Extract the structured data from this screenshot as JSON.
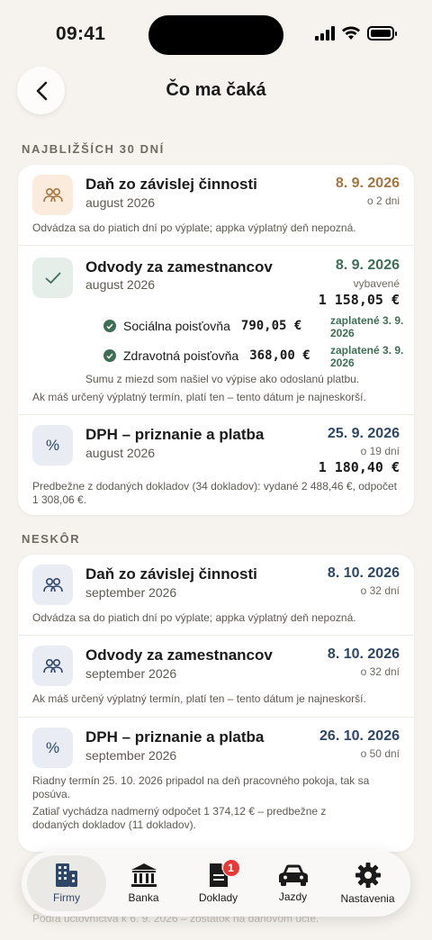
{
  "status": {
    "time": "09:41"
  },
  "header": {
    "title": "Čo ma čaká"
  },
  "sections": {
    "next30": "NAJBLIŽŠÍCH 30 DNÍ",
    "later": "NESKÔR"
  },
  "next30": {
    "tax1": {
      "title": "Daň zo závislej činnosti",
      "period": "august 2026",
      "date": "8. 9. 2026",
      "due_in": "o 2 dni",
      "note": "Odvádza sa do piatich dní po výplate; appka výplatný deň nepozná."
    },
    "contrib": {
      "title": "Odvody za zamestnancov",
      "period": "august 2026",
      "date": "8. 9. 2026",
      "status": "vybavené",
      "amount": "1 158,05 €",
      "rows": [
        {
          "label": "Sociálna poisťovňa",
          "amount": "790,05 €",
          "paid": "zaplatené 3. 9. 2026"
        },
        {
          "label": "Zdravotná poisťovňa",
          "amount": "368,00 €",
          "paid": "zaplatené 3. 9. 2026"
        }
      ],
      "note1": "Sumu z miezd som našiel vo výpise ako odoslanú platbu.",
      "note2": "Ak máš určený výplatný termín, platí ten – tento dátum je najneskorší."
    },
    "vat": {
      "title": "DPH – priznanie a platba",
      "period": "august 2026",
      "date": "25. 9. 2026",
      "due_in": "o 19 dní",
      "amount": "1 180,40 €",
      "note": "Predbežne z dodaných dokladov (34 dokladov): vydané 2 488,46 €, odpočet 1 308,06 €."
    }
  },
  "later": {
    "tax2": {
      "title": "Daň zo závislej činnosti",
      "period": "september 2026",
      "date": "8. 10. 2026",
      "due_in": "o 32 dní",
      "note": "Odvádza sa do piatich dní po výplate; appka výplatný deň nepozná."
    },
    "contrib2": {
      "title": "Odvody za zamestnancov",
      "period": "september 2026",
      "date": "8. 10. 2026",
      "due_in": "o 32 dní",
      "note": "Ak máš určený výplatný termín, platí ten – tento dátum je najneskorší."
    },
    "vat2": {
      "title": "DPH – priznanie a platba",
      "period": "september 2026",
      "date": "26. 10. 2026",
      "due_in": "o 50 dní",
      "note1": "Riadny termín 25. 10. 2026 pripadol na deň pracovného pokoja, tak sa posúva.",
      "note2": "Zatiaľ vychádza nadmerný odpočet 1 374,12 € – predbežne z dodaných dokladov (11 dokladov)."
    }
  },
  "faded": "Podľa účtovníctva k 6. 9. 2026 – zostatok na daňovom účte.",
  "tabs": [
    {
      "label": "Firmy",
      "icon": "building-icon"
    },
    {
      "label": "Banka",
      "icon": "bank-icon"
    },
    {
      "label": "Doklady",
      "icon": "document-icon",
      "badge": "1"
    },
    {
      "label": "Jazdy",
      "icon": "car-icon"
    },
    {
      "label": "Nastavenia",
      "icon": "gear-icon"
    }
  ],
  "colors": {
    "accent_blue": "#2F4766",
    "accent_green": "#3E6E55",
    "accent_orange": "#A6743F",
    "badge_red": "#E53935"
  }
}
